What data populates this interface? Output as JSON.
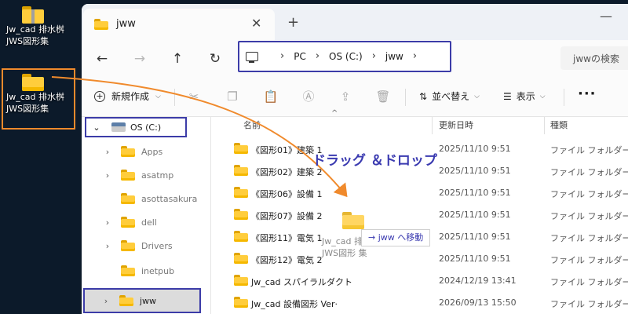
{
  "desktop": {
    "icons": [
      {
        "label": "Jw_cad 排水桝\nJWS図形集",
        "icon": "zip-folder-icon"
      },
      {
        "label": "Jw_cad 排水桝\nJWS図形集",
        "icon": "folder-icon"
      }
    ]
  },
  "window": {
    "tab_title": "jww",
    "tab_close": "✕",
    "new_tab": "+",
    "minimize": "—"
  },
  "nav": {
    "back": "←",
    "forward": "→",
    "up": "↑",
    "refresh": "↻",
    "breadcrumb": [
      "PC",
      "OS (C:)",
      "jww"
    ],
    "chevron": "›",
    "search_placeholder": "jwwの検索"
  },
  "toolbar": {
    "new_label": "新規作成",
    "sort_label": "並べ替え",
    "view_label": "表示",
    "more": "···"
  },
  "sidebar": {
    "root": "OS (C:)",
    "items": [
      "Apps",
      "asatmp",
      "asottasakura",
      "dell",
      "Drivers",
      "inetpub",
      "jww"
    ]
  },
  "columns": {
    "name": "名前",
    "date": "更新日時",
    "type": "種類"
  },
  "files": [
    {
      "name": "《図形01》建築 1",
      "date": "2025/11/10 9:51",
      "type": "ファイル フォルダー"
    },
    {
      "name": "《図形02》建築 2",
      "date": "2025/11/10 9:51",
      "type": "ファイル フォルダー"
    },
    {
      "name": "《図形06》設備 1",
      "date": "2025/11/10 9:51",
      "type": "ファイル フォルダー"
    },
    {
      "name": "《図形07》設備 2",
      "date": "2025/11/10 9:51",
      "type": "ファイル フォルダー"
    },
    {
      "name": "《図形11》電気 1",
      "date": "2025/11/10 9:51",
      "type": "ファイル フォルダー"
    },
    {
      "name": "《図形12》電気 2",
      "date": "2025/11/10 9:51",
      "type": "ファイル フォルダー"
    },
    {
      "name": "Jw_cad スパイラルダクト",
      "date": "2024/12/19 13:41",
      "type": "ファイル フォルダー"
    },
    {
      "name": "Jw_cad 設備図形 Ver·",
      "date": "2026/09/13 15:50",
      "type": "ファイル フォルダー"
    }
  ],
  "drag": {
    "caption": "ドラッグ ＆ドロップ",
    "ghost_label": "Jw_cad 排\nJWS図形 集",
    "tooltip": "→ jww へ移動"
  },
  "colors": {
    "annotation_blue": "#3c3ca8",
    "annotation_orange": "#f08a2c"
  }
}
